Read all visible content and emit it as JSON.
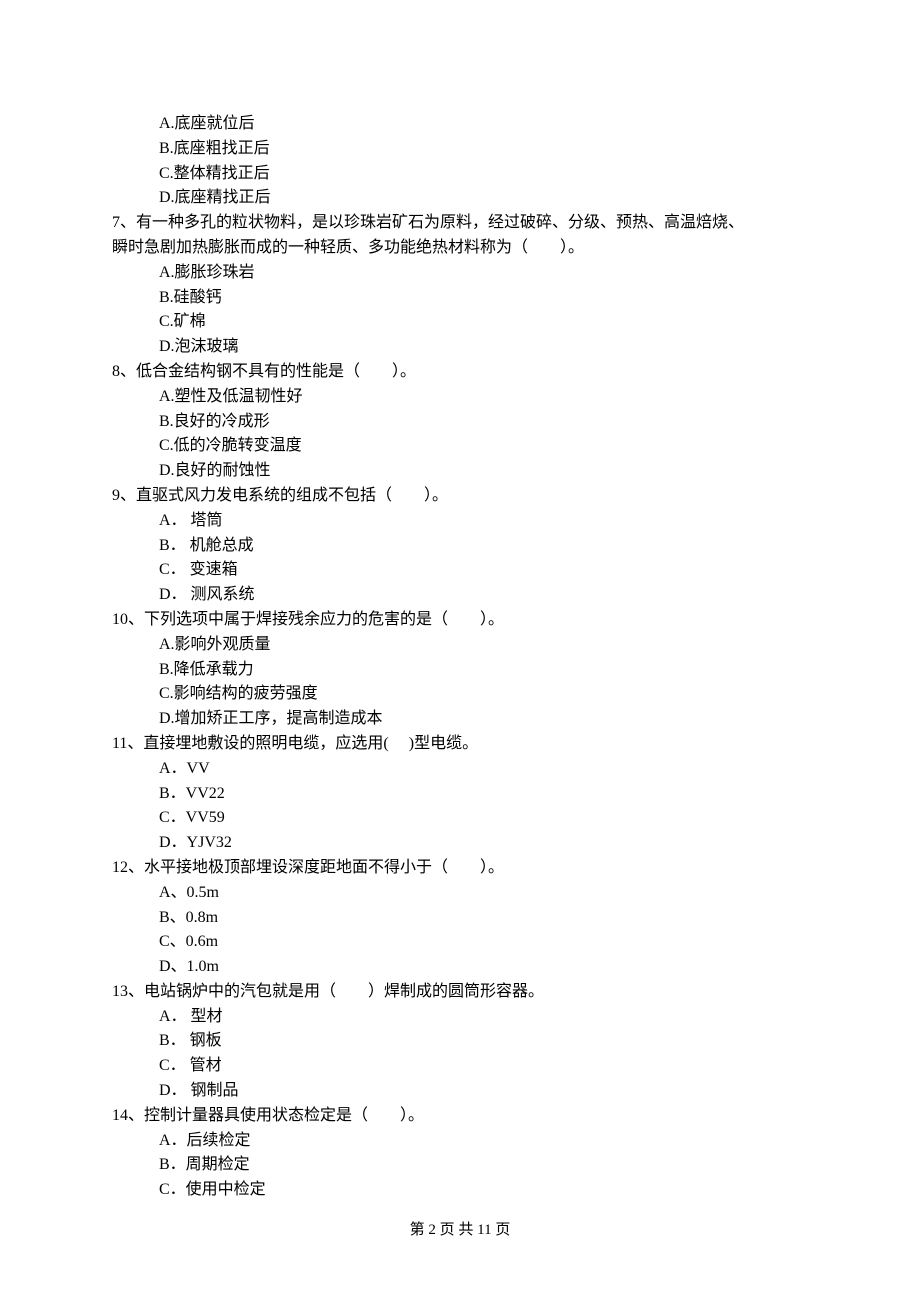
{
  "q6_options": {
    "a": "A.底座就位后",
    "b": "B.底座粗找正后",
    "c": "C.整体精找正后",
    "d": "D.底座精找正后"
  },
  "q7": {
    "text_line1": "7、有一种多孔的粒状物料，是以珍珠岩矿石为原料，经过破碎、分级、预热、高温焙烧、",
    "text_line2": "瞬时急剧加热膨胀而成的一种轻质、多功能绝热材料称为（　　）。",
    "a": "A.膨胀珍珠岩",
    "b": "B.硅酸钙",
    "c": "C.矿棉",
    "d": "D.泡沫玻璃"
  },
  "q8": {
    "text": "8、低合金结构钢不具有的性能是（　　）。",
    "a": "A.塑性及低温韧性好",
    "b": "B.良好的冷成形",
    "c": "C.低的冷脆转变温度",
    "d": "D.良好的耐蚀性"
  },
  "q9": {
    "text": "9、直驱式风力发电系统的组成不包括（　　）。",
    "a": "A． 塔筒",
    "b": "B． 机舱总成",
    "c": "C． 变速箱",
    "d": "D． 测风系统"
  },
  "q10": {
    "text": "10、下列选项中属于焊接残余应力的危害的是（　　）。",
    "a": "A.影响外观质量",
    "b": "B.降低承载力",
    "c": "C.影响结构的疲劳强度",
    "d": "D.增加矫正工序，提高制造成本"
  },
  "q11": {
    "text": "11、直接埋地敷设的照明电缆，应选用(　 )型电缆。",
    "a": "A．VV",
    "b": "B．VV22",
    "c": "C．VV59",
    "d": "D．YJV32"
  },
  "q12": {
    "text": "12、水平接地极顶部埋设深度距地面不得小于（　　）。",
    "a": "A、0.5m",
    "b": "B、0.8m",
    "c": "C、0.6m",
    "d": "D、1.0m"
  },
  "q13": {
    "text": "13、电站锅炉中的汽包就是用（　　）焊制成的圆筒形容器。",
    "a": "A． 型材",
    "b": "B． 钢板",
    "c": "C． 管材",
    "d": "D． 钢制品"
  },
  "q14": {
    "text": "14、控制计量器具使用状态检定是（　　）。",
    "a": "A．后续检定",
    "b": "B．周期检定",
    "c": "C．使用中检定"
  },
  "footer": "第 2 页 共 11 页"
}
